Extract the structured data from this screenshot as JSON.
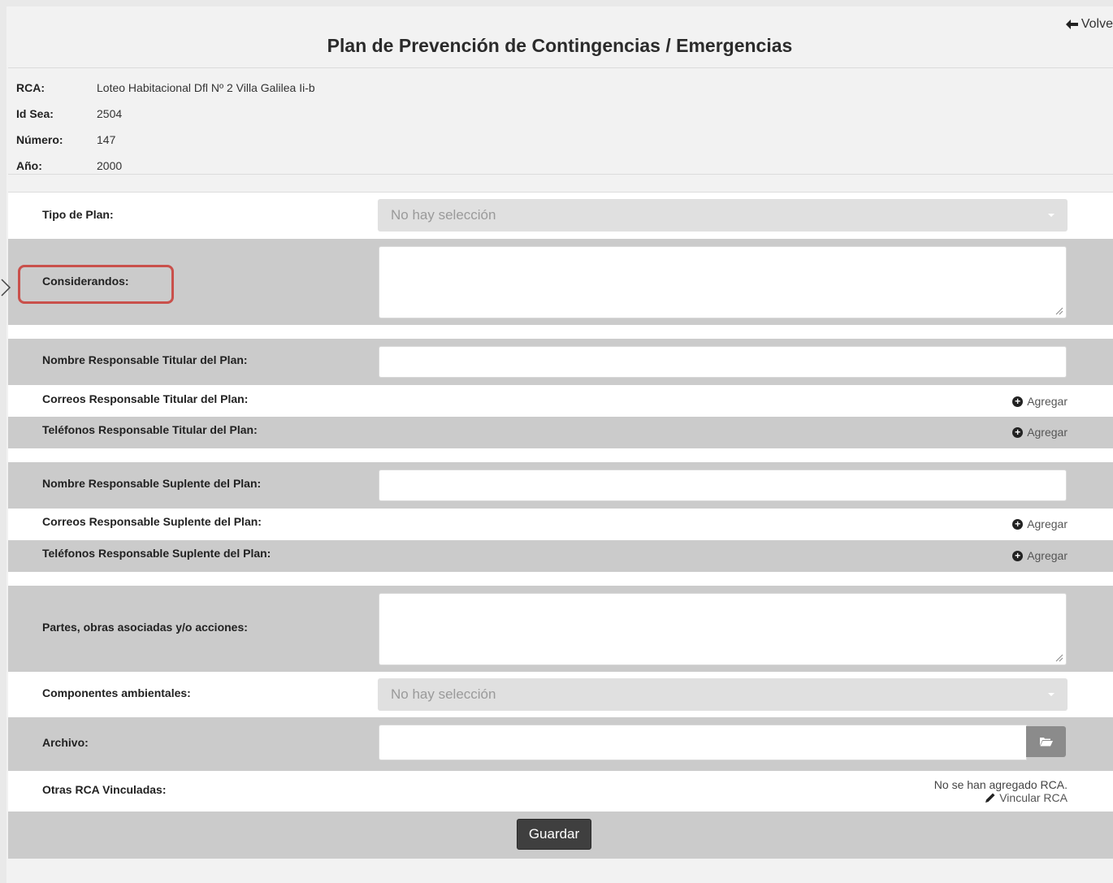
{
  "header": {
    "back_label": "Volve",
    "title": "Plan de Prevención de Contingencias / Emergencias"
  },
  "info": [
    {
      "key": "RCA:",
      "value": "Loteo Habitacional Dfl Nº 2 Villa Galilea Ii-b"
    },
    {
      "key": "Id Sea:",
      "value": "2504"
    },
    {
      "key": "Número:",
      "value": "147"
    },
    {
      "key": "Año:",
      "value": "2000"
    }
  ],
  "form": {
    "tipo_plan": {
      "label": "Tipo de Plan:",
      "placeholder": "No hay selección"
    },
    "considerandos": {
      "label": "Considerandos:"
    },
    "nombre_titular": {
      "label": "Nombre Responsable Titular del Plan:"
    },
    "correos_titular": {
      "label": "Correos Responsable Titular del Plan:",
      "add": "Agregar"
    },
    "telefonos_titular": {
      "label": "Teléfonos Responsable Titular del Plan:",
      "add": "Agregar"
    },
    "nombre_suplente": {
      "label": "Nombre Responsable Suplente del Plan:"
    },
    "correos_suplente": {
      "label": "Correos Responsable Suplente del Plan:",
      "add": "Agregar"
    },
    "telefonos_suplente": {
      "label": "Teléfonos Responsable Suplente del Plan:",
      "add": "Agregar"
    },
    "partes": {
      "label": "Partes, obras asociadas y/o acciones:"
    },
    "componentes": {
      "label": "Componentes ambientales:",
      "placeholder": "No hay selección"
    },
    "archivo": {
      "label": "Archivo:"
    },
    "otras_rca": {
      "label": "Otras RCA Vinculadas:",
      "empty_text": "No se han agregado RCA.",
      "link": "Vincular RCA"
    },
    "save_label": "Guardar"
  },
  "colors": {
    "highlight": "#c9504b",
    "button": "#3f3f3f"
  }
}
